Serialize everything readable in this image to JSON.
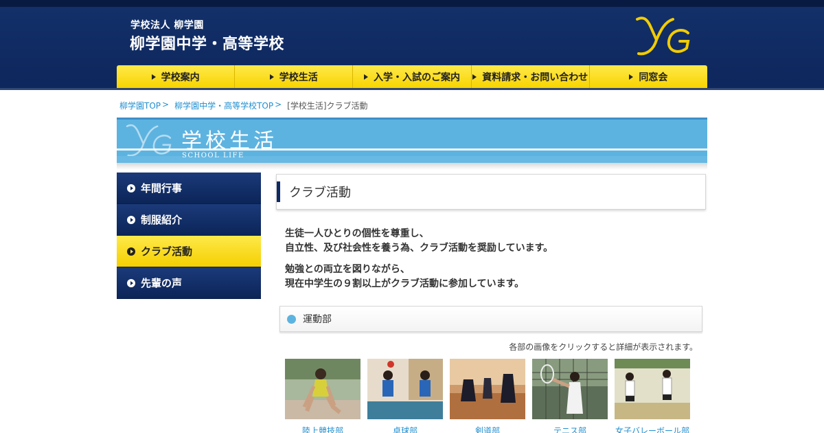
{
  "header": {
    "sub_title": "学校法人 柳学園",
    "title": "柳学園中学・高等学校"
  },
  "gnav": [
    {
      "label": "学校案内"
    },
    {
      "label": "学校生活"
    },
    {
      "label": "入学・入試のご案内"
    },
    {
      "label": "資料請求・お問い合わせ"
    },
    {
      "label": "同窓会"
    }
  ],
  "breadcrumb": {
    "items": [
      "柳学園TOP",
      "柳学園中学・高等学校TOP"
    ],
    "current": "[学校生活]クラブ活動"
  },
  "banner": {
    "title": "学校生活",
    "subtitle": "SCHOOL LIFE"
  },
  "sidenav": [
    {
      "label": "年間行事",
      "active": false
    },
    {
      "label": "制服紹介",
      "active": false
    },
    {
      "label": "クラブ活動",
      "active": true
    },
    {
      "label": "先輩の声",
      "active": false
    }
  ],
  "main": {
    "heading": "クラブ活動",
    "intro": [
      [
        "生徒一人ひとりの個性を尊重し、",
        "自立性、及び社会性を養う為、クラブ活動を奨励しています。"
      ],
      [
        "勉強との両立を図りながら、",
        "現在中学生の９割以上がクラブ活動に参加しています。"
      ]
    ],
    "section_heading": "運動部",
    "note": "各部の画像をクリックすると詳細が表示されます。",
    "clubs": [
      {
        "label": "陸上競技部"
      },
      {
        "label": "卓球部"
      },
      {
        "label": "剣道部"
      },
      {
        "label": "テニス部"
      },
      {
        "label": "女子バレーボール部"
      }
    ]
  },
  "colors": {
    "navy": "#0e275c",
    "yellow": "#ffe94a",
    "sky": "#5db3e0",
    "link": "#1f8fd0"
  }
}
